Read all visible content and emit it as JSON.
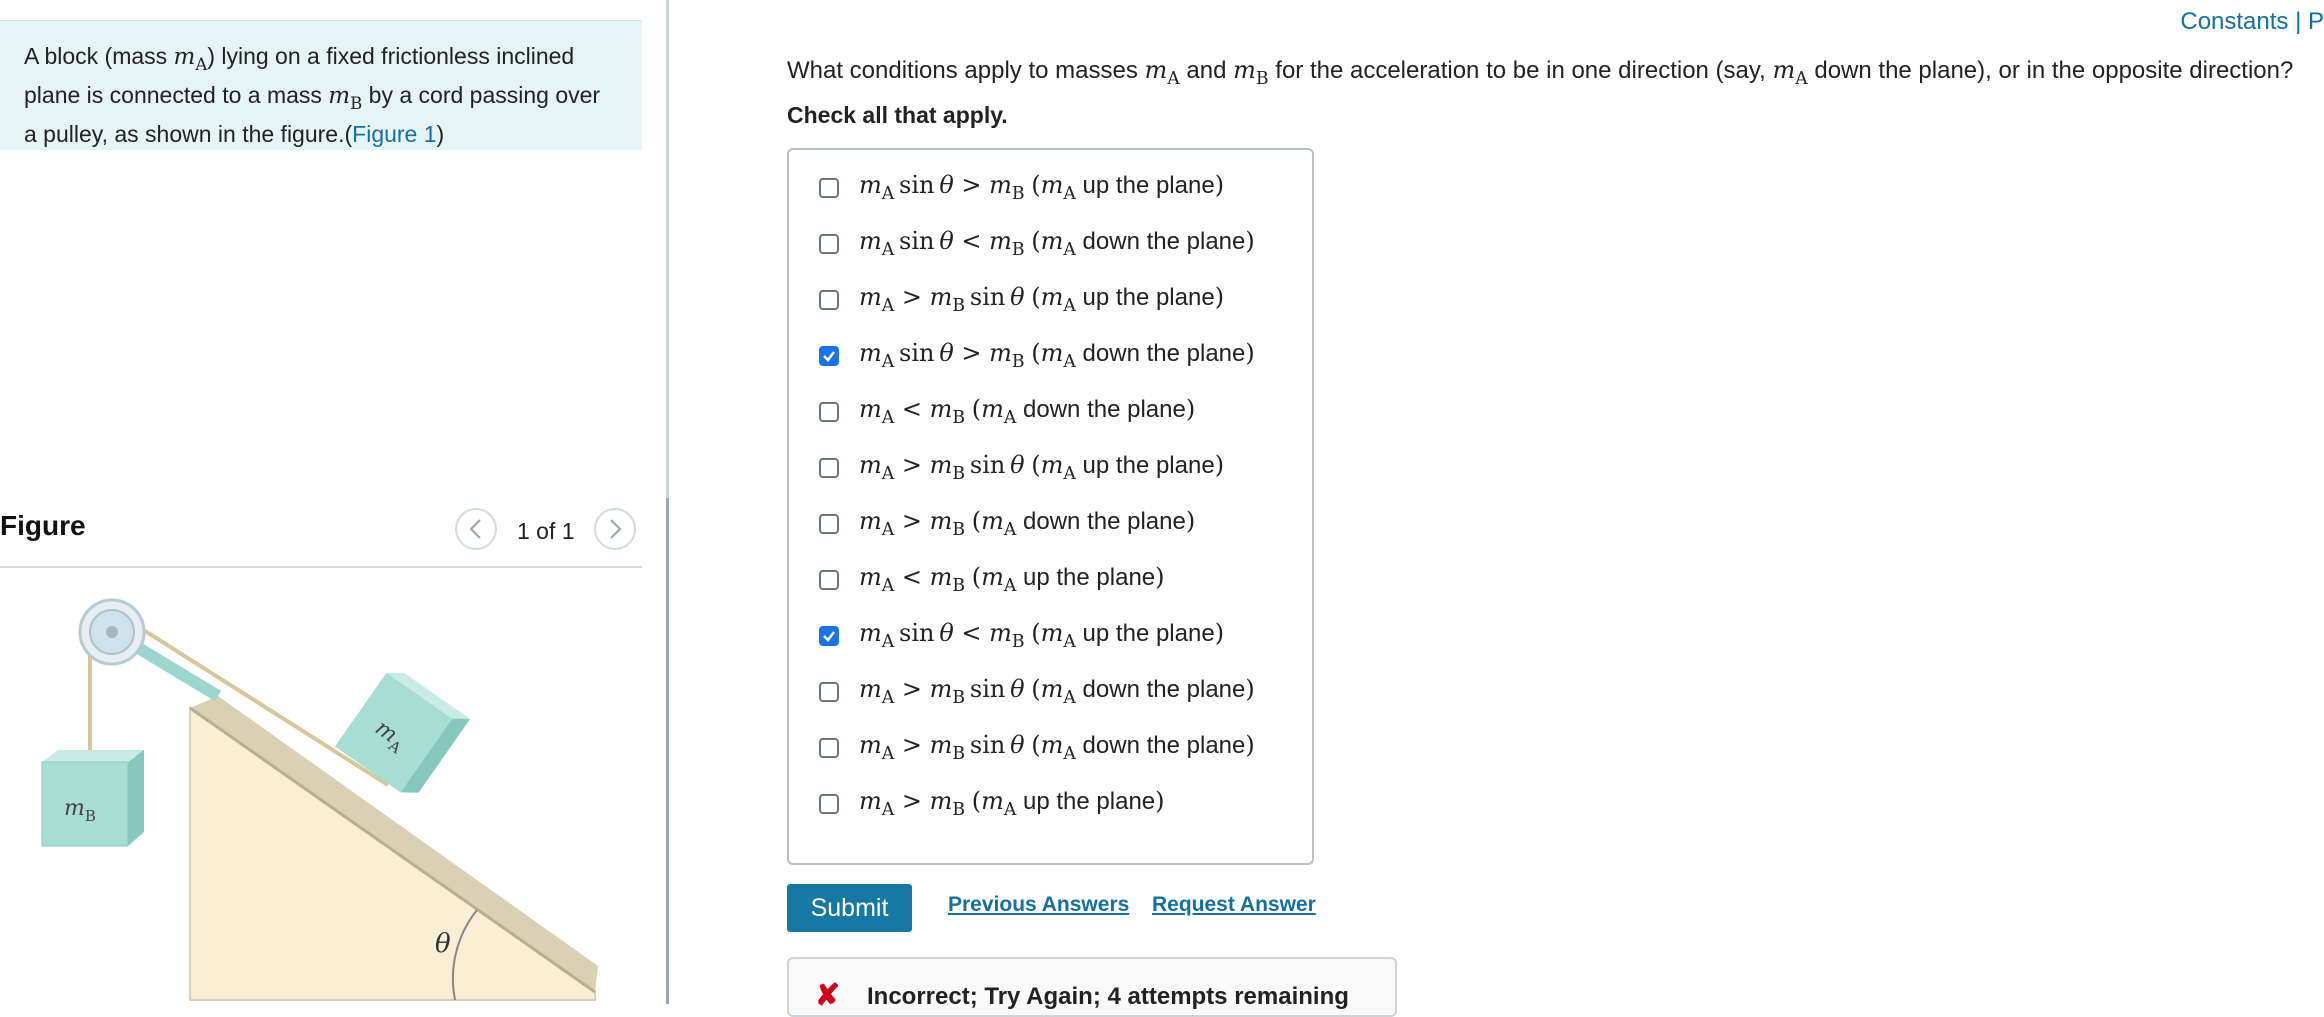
{
  "intro": {
    "line1_pre": "A block (mass ",
    "line1_post": ") lying on a fixed frictionless inclined",
    "line2_pre": "plane is connected to a mass ",
    "line2_post": " by a cord passing over",
    "line3": "a pulley, as shown in the figure.(",
    "figure_link": "Figure 1",
    "line3_close": ")"
  },
  "figure": {
    "heading": "Figure",
    "counter": "1 of 1",
    "prev_icon": "chevron-left-icon",
    "next_icon": "chevron-right-icon",
    "label_mB": "m",
    "label_mA": "m",
    "sub_B": "B",
    "sub_A": "A",
    "angle": "θ"
  },
  "header": {
    "constants": "Constants | P"
  },
  "question": {
    "text_1": "What conditions apply to masses ",
    "text_2": " and ",
    "text_3": " for the acceleration to be in one direction (say, ",
    "text_4": " down the plane), or in the opposite direction?",
    "instruction": "Check all that apply."
  },
  "options": [
    {
      "lhs": "m_A sin θ",
      "op": ">",
      "rhs": "m_B",
      "dir": "up the plane",
      "checked": false
    },
    {
      "lhs": "m_A sin θ",
      "op": "<",
      "rhs": "m_B",
      "dir": "down the plane",
      "checked": false
    },
    {
      "lhs": "m_A",
      "op": ">",
      "rhs": "m_B sin θ",
      "dir": "up the plane",
      "checked": false
    },
    {
      "lhs": "m_A sin θ",
      "op": ">",
      "rhs": "m_B",
      "dir": "down the plane",
      "checked": true
    },
    {
      "lhs": "m_A",
      "op": "<",
      "rhs": "m_B",
      "dir": "down the plane",
      "checked": false
    },
    {
      "lhs": "m_A",
      "op": ">",
      "rhs": "m_B sin θ",
      "dir": "up the plane",
      "checked": false
    },
    {
      "lhs": "m_A",
      "op": ">",
      "rhs": "m_B",
      "dir": "down the plane",
      "checked": false
    },
    {
      "lhs": "m_A",
      "op": "<",
      "rhs": "m_B",
      "dir": "up the plane",
      "checked": false
    },
    {
      "lhs": "m_A sin θ",
      "op": "<",
      "rhs": "m_B",
      "dir": "up the plane",
      "checked": true
    },
    {
      "lhs": "m_A",
      "op": ">",
      "rhs": "m_B sin θ",
      "dir": "down the plane",
      "checked": false
    },
    {
      "lhs": "m_A",
      "op": ">",
      "rhs": "m_B sin θ",
      "dir": "down the plane",
      "checked": false
    },
    {
      "lhs": "m_A",
      "op": ">",
      "rhs": "m_B",
      "dir": "up the plane",
      "checked": false
    }
  ],
  "actions": {
    "submit": "Submit",
    "previous_answers": "Previous Answers",
    "request_answer": "Request Answer"
  },
  "feedback": {
    "icon": "x-mark-icon",
    "text": "Incorrect; Try Again; 4 attempts remaining"
  },
  "colors": {
    "link": "#1470a3",
    "submit_bg": "#1679a3",
    "checkbox_checked": "#1a73e8",
    "intro_bg": "#e7f4f5",
    "error": "#d0021b"
  }
}
